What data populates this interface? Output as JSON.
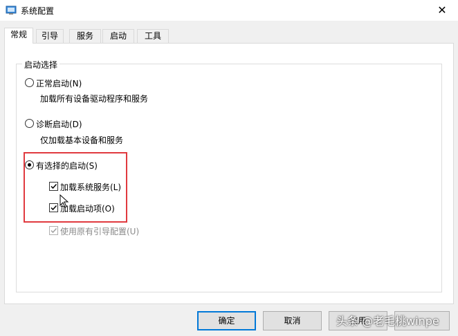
{
  "window": {
    "title": "系统配置",
    "close_icon": "✕"
  },
  "tabs": [
    {
      "label": "常规",
      "active": true
    },
    {
      "label": "引导",
      "active": false
    },
    {
      "label": "服务",
      "active": false
    },
    {
      "label": "启动",
      "active": false
    },
    {
      "label": "工具",
      "active": false
    }
  ],
  "startup": {
    "legend": "启动选择",
    "normal": {
      "label": "正常启动(N)",
      "desc": "加载所有设备驱动程序和服务",
      "checked": false
    },
    "diagnostic": {
      "label": "诊断启动(D)",
      "desc": "仅加载基本设备和服务",
      "checked": false
    },
    "selective": {
      "label": "有选择的启动(S)",
      "checked": true,
      "load_services": {
        "label": "加载系统服务(L)",
        "checked": true
      },
      "load_startup": {
        "label": "加载启动项(O)",
        "checked": true
      },
      "use_original_boot": {
        "label": "使用原有引导配置(U)",
        "checked": true,
        "disabled": true
      }
    }
  },
  "buttons": {
    "ok": "确定",
    "cancel": "取消",
    "apply": "应用"
  },
  "watermark": "头条 @老毛桃winpe",
  "colors": {
    "highlight": "#e0393e",
    "accent": "#0078d7"
  }
}
